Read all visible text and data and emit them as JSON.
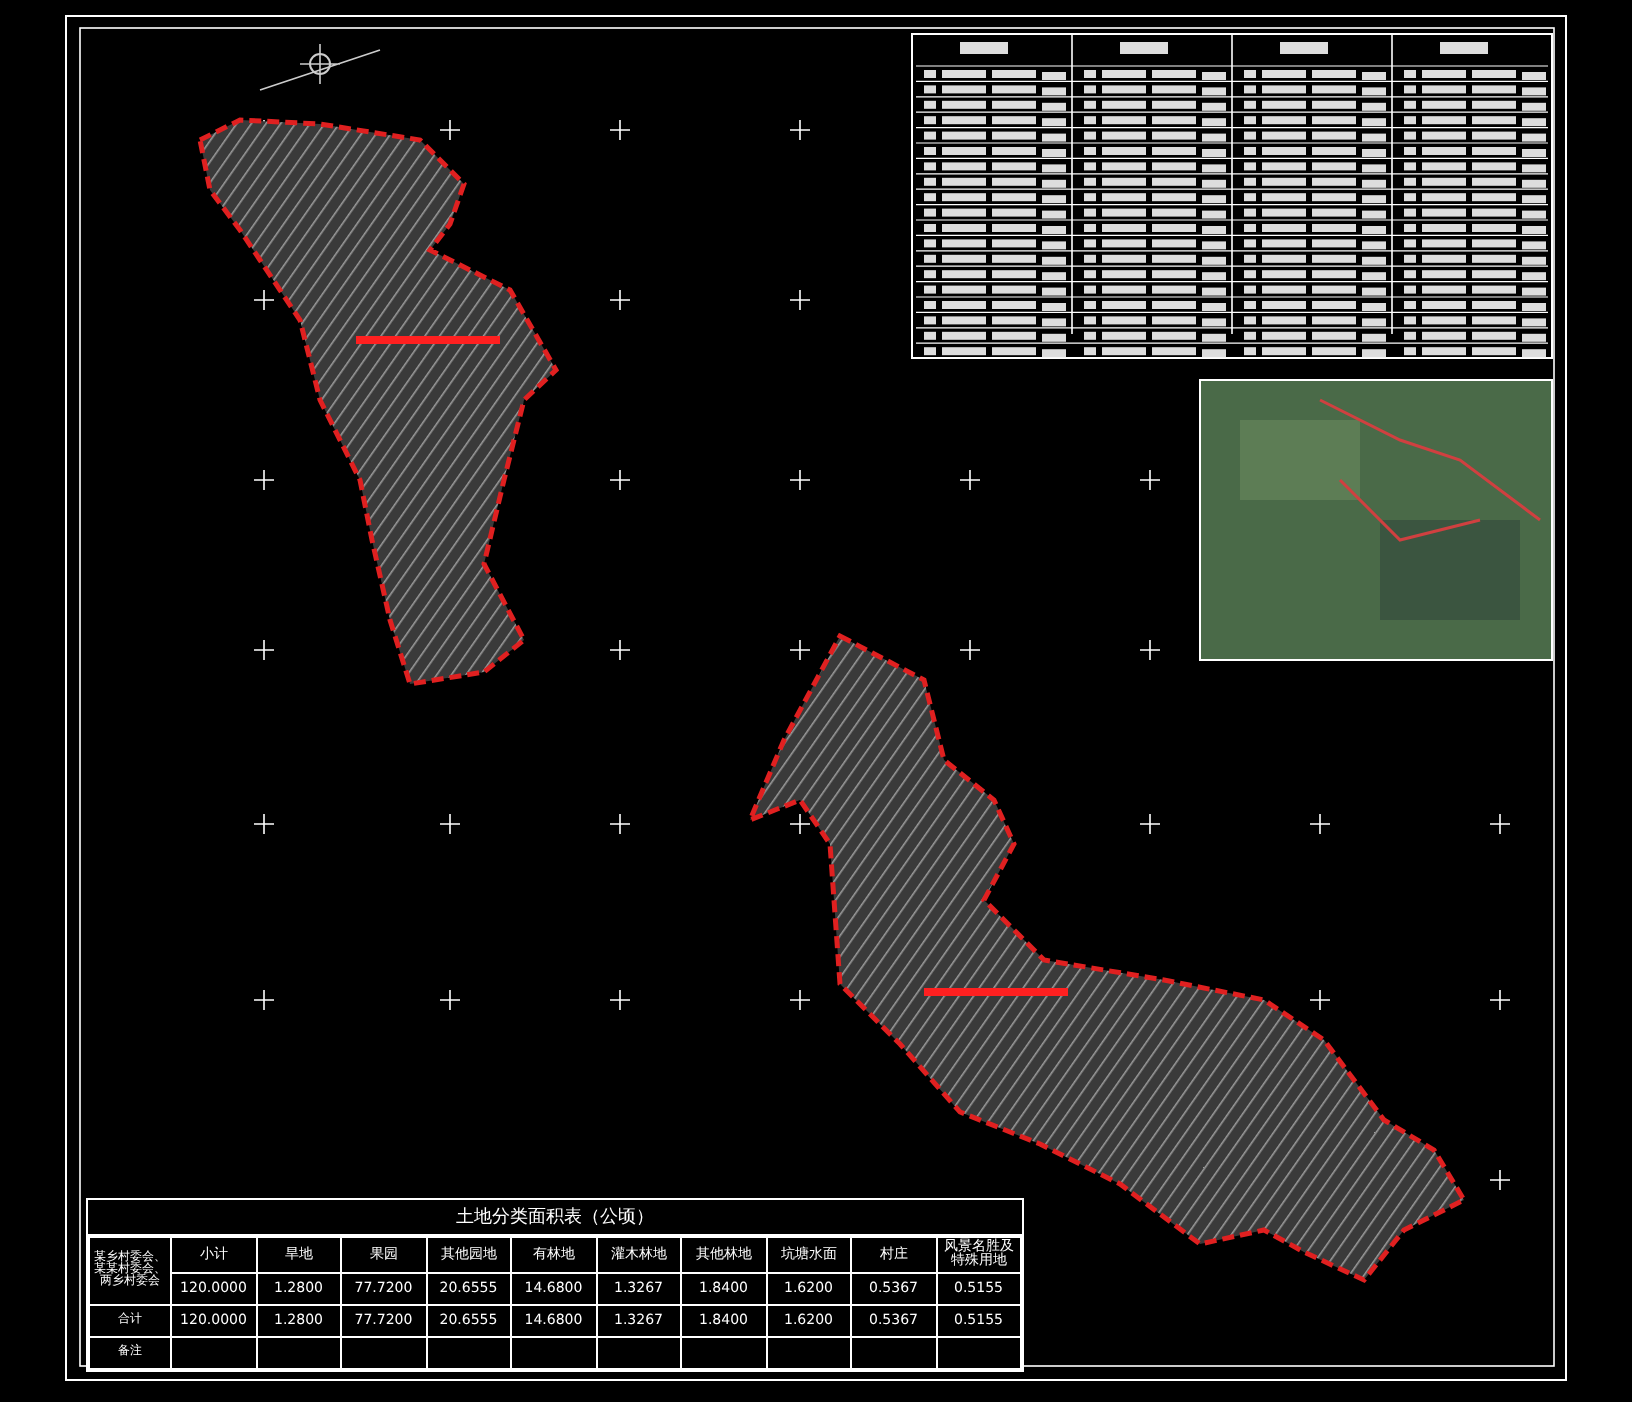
{
  "area_table": {
    "title": "土地分类面积表（公顷）",
    "columns": [
      "小计",
      "旱地",
      "果园",
      "其他园地",
      "有林地",
      "灌木林地",
      "其他林地",
      "坑塘水面",
      "村庄",
      "风景名胜及特殊用地"
    ],
    "rows": [
      {
        "label": "某乡村委会、某某村委会、两乡村委会",
        "cells": [
          "120.0000",
          "1.2800",
          "77.7200",
          "20.6555",
          "14.6800",
          "1.3267",
          "1.8400",
          "1.6200",
          "0.5367",
          "0.5155"
        ]
      },
      {
        "label": "合计",
        "cells": [
          "120.0000",
          "1.2800",
          "77.7200",
          "20.6555",
          "14.6800",
          "1.3267",
          "1.8400",
          "1.6200",
          "0.5367",
          "0.5155"
        ]
      }
    ],
    "remark_label": "备注"
  }
}
